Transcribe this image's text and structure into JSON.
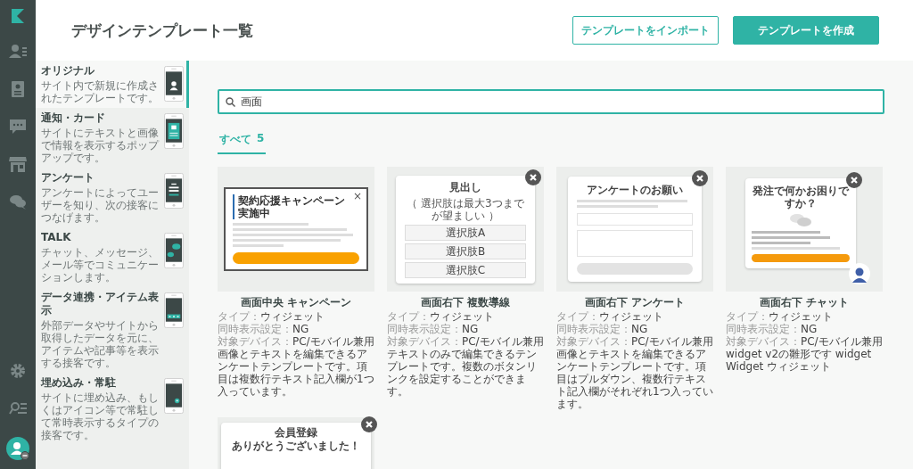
{
  "header": {
    "title": "デザインテンプレート一覧",
    "buttons": [
      {
        "label": "テンプレートをインポート",
        "kind": "outline"
      },
      {
        "label": "テンプレートを作成",
        "kind": "primary"
      }
    ]
  },
  "categories": [
    {
      "title": "オリジナル",
      "description": "サイト内で新規に作成されたテンプレートです。",
      "selected": true,
      "kind": "profile"
    },
    {
      "title": "通知・カード",
      "description": "サイトにテキストと画像で情報を表示するポップアップです。",
      "selected": false,
      "kind": "card"
    },
    {
      "title": "アンケート",
      "description": "アンケートによってユーザーを知り、次の接客につなげます。",
      "selected": false,
      "kind": "survey"
    },
    {
      "title": "TALK",
      "description": "チャット、メッセージ、メール等でコミュニケーションします。",
      "selected": false,
      "kind": "talk"
    },
    {
      "title": "データ連携・アイテム表示",
      "description": "外部データやサイトから取得したデータを元に、アイテムや記事等を表示する接客です。",
      "selected": false,
      "kind": "data"
    },
    {
      "title": "埋め込み・常駐",
      "description": "サイトに埋め込み、もしくはアイコン等で常駐して常時表示するタイプの接客です。",
      "selected": false,
      "kind": "embed"
    }
  ],
  "search": {
    "value": "画面"
  },
  "filter_tabs": [
    {
      "label": "すべて",
      "count": "5",
      "selected": true
    }
  ],
  "templates": [
    {
      "name": "画面中央 キャンペーン",
      "type_label": "タイプ：",
      "type": "ウィジェット",
      "concurrent_label": "同時表示設定：",
      "concurrent": "NG",
      "device_label": "対象デバイス：",
      "device": "PC/モバイル兼用",
      "description": "画像とテキストを編集できるアンケートテンプレートです。項目は複数行テキスト記入欄が1つ入っています。",
      "preview": {
        "kind": "campaign",
        "heading": "契約応援キャンペーン実施中",
        "close": "×"
      }
    },
    {
      "name": "画面右下 複数導線",
      "type_label": "タイプ：",
      "type": "ウィジェット",
      "concurrent_label": "同時表示設定：",
      "concurrent": "NG",
      "device_label": "対象デバイス：",
      "device": "PC/モバイル兼用",
      "description": "テキストのみで編集できるテンプレートです。複数のボタンリンクを設定することができます。",
      "preview": {
        "kind": "choices",
        "heading": "見出し",
        "note": "（ 選択肢は最大3つまでが望ましい ）",
        "options": [
          "選択肢A",
          "選択肢B",
          "選択肢C"
        ]
      }
    },
    {
      "name": "画面右下 アンケート",
      "type_label": "タイプ：",
      "type": "ウィジェット",
      "concurrent_label": "同時表示設定：",
      "concurrent": "NG",
      "device_label": "対象デバイス：",
      "device": "PC/モバイル兼用",
      "description": "画像とテキストを編集できるアンケートテンプレートです。項目はプルダウン、複数行テキスト記入欄がそれぞれ1つ入っています。",
      "preview": {
        "kind": "survey",
        "heading": "アンケートのお願い"
      }
    },
    {
      "name": "画面右下 チャット",
      "type_label": "タイプ：",
      "type": "ウィジェット",
      "concurrent_label": "同時表示設定：",
      "concurrent": "NG",
      "device_label": "対象デバイス：",
      "device": "PC/モバイル兼用",
      "description": "widget v2の雛形です widget Widget ウィジェット",
      "preview": {
        "kind": "chat",
        "heading": "発注で何かお困りですか？"
      }
    },
    {
      "preview": {
        "kind": "signup",
        "lines": [
          "会員登録",
          "ありがとうございました！"
        ]
      }
    }
  ]
}
